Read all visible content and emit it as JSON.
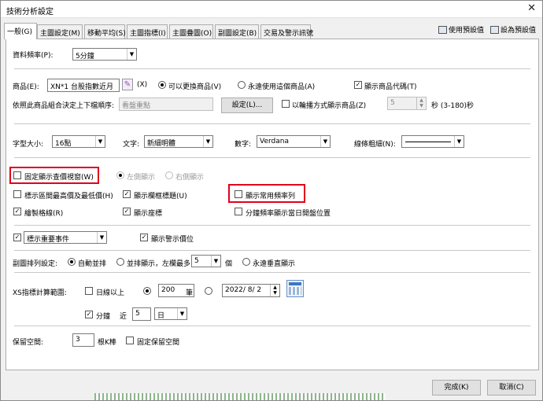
{
  "window": {
    "title": "技術分析設定",
    "close": "✕"
  },
  "tabs": [
    "一般(G)",
    "主圖設定(M)",
    "移動平均(S)",
    "主圖指標(I)",
    "主圖疊圖(O)",
    "副圖設定(B)",
    "交易及警示訊號"
  ],
  "topright": {
    "use_default": "使用預設值",
    "set_default": "設為預設值"
  },
  "general": {
    "freq_label": "資料頻率(P):",
    "freq_value": "5分鐘",
    "product_label": "商品(E):",
    "product_value": "XN*1 台股指數近月",
    "product_code": "(X)",
    "radio_changeable": "可以更換商品(V)",
    "radio_fixed": "永遠使用這個商品(A)",
    "show_code": "顯示商品代碼(T)",
    "group_label": "依照此商品組合決定上下檔順序:",
    "group_value": "看盤重點",
    "group_button": "設定(L)...",
    "rotate_label": "以輪播方式顯示商品(Z)",
    "rotate_value": "5",
    "rotate_unit": "秒 (3-180)秒",
    "fontsize_label": "字型大小:",
    "fontsize_value": "16點",
    "text_label": "文字:",
    "text_value": "新細明體",
    "number_label": "數字:",
    "number_value": "Verdana",
    "line_label": "線條粗細(N):",
    "fixed_window": "固定顯示查價視窗(W)",
    "left_show": "左側顯示",
    "right_show": "右側顯示",
    "show_high_low": "標示區間最高價及最低價(H)",
    "show_title": "顯示欄框標題(U)",
    "show_freq_row": "顯示常用頻率列",
    "draw_grid": "繪製格線(R)",
    "show_coord": "顯示座標",
    "split_freq": "分鐘頻率顯示當日開盤位置",
    "mark_event": "標示重要事件",
    "show_alert": "顯示警示價位",
    "subchart_label": "副圖排列設定:",
    "auto_arrange": "自動並排",
    "side_arrange": "並排顯示，左欄最多",
    "side_count": "5",
    "side_unit": "個",
    "always_vertical": "永遠垂直顯示",
    "xs_label": "XS指標計算範圍:",
    "day_above": "日線以上",
    "count_value": "200",
    "count_unit": "筆",
    "date_value": "2022/  8/  2",
    "minute": "分鐘",
    "recent": "近",
    "recent_value": "5",
    "recent_unit": "日",
    "reserve_label": "保留空間:",
    "reserve_value": "3",
    "reserve_unit": "根K棒",
    "fixed_reserve": "固定保留空間"
  },
  "checkmark": "✓",
  "buttons": {
    "ok": "完成(K)",
    "cancel": "取消(C)"
  }
}
